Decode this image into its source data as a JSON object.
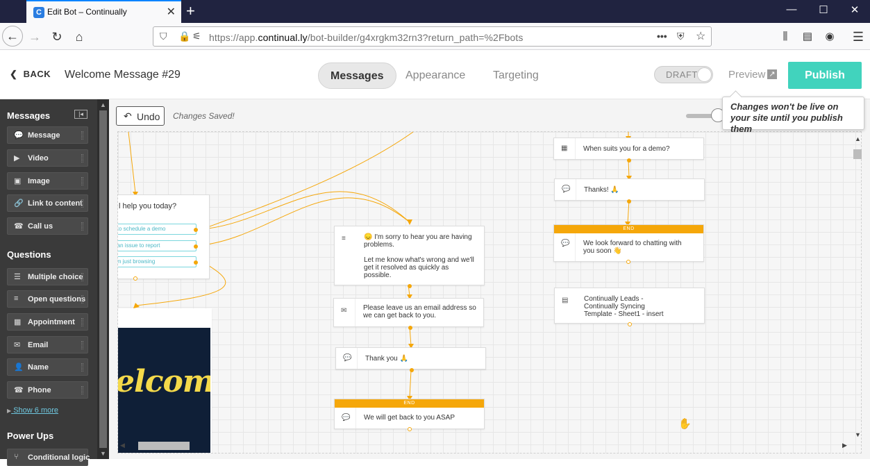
{
  "browser": {
    "tab_title": "Edit Bot – Continually",
    "favicon": "C",
    "url_prefix": "https://app.",
    "url_domain": "continual.ly",
    "url_rest": "/bot-builder/g4xrgkm32rn3?return_path=%2Fbots"
  },
  "header": {
    "back_label": "BACK",
    "page_title": "Welcome Message #29",
    "tabs": [
      "Messages",
      "Appearance",
      "Targeting"
    ],
    "draft_label": "DRAFT",
    "preview_label": "Preview",
    "publish_label": "Publish"
  },
  "sidebar": {
    "messages_heading": "Messages",
    "message_items": [
      {
        "label": "Message",
        "icon": "chat-icon"
      },
      {
        "label": "Video",
        "icon": "video-icon"
      },
      {
        "label": "Image",
        "icon": "image-icon"
      },
      {
        "label": "Link to content",
        "icon": "link-icon"
      },
      {
        "label": "Call us",
        "icon": "phone-icon"
      }
    ],
    "questions_heading": "Questions",
    "question_items": [
      {
        "label": "Multiple choice",
        "icon": "list-icon"
      },
      {
        "label": "Open questions",
        "icon": "lines-icon"
      },
      {
        "label": "Appointment",
        "icon": "calendar-icon"
      },
      {
        "label": "Email",
        "icon": "envelope-icon"
      },
      {
        "label": "Name",
        "icon": "user-icon"
      },
      {
        "label": "Phone",
        "icon": "phone-icon"
      }
    ],
    "show_more": "Show 6 more",
    "powerups_heading": "Power Ups",
    "powerup_items": [
      {
        "label": "Conditional logic",
        "icon": "branch-icon"
      }
    ]
  },
  "toolbar": {
    "undo_label": "Undo",
    "status": "Changes Saved!",
    "tooltip": "Changes won't be live on your site until you publish them"
  },
  "nodes": {
    "question_title": "l help you today?",
    "choices": [
      "e to schedule a demo",
      "e an issue to report",
      "I'm just browsing"
    ],
    "welcome_image_text": "elcome",
    "sorry_text_1": "😞 I'm sorry to hear you are having problems.",
    "sorry_text_2": "Let me know what's wrong and we'll get it resolved as quickly as possible.",
    "email_text": "Please leave us an email address so we can get back to you.",
    "thank_you_text": "Thank you 🙏",
    "asap_text": "We will get back to you ASAP",
    "end_label": "END",
    "demo_text": "When suits you for a demo?",
    "thanks_text": "Thanks! 🙏",
    "look_forward_text": "We look forward to chatting with you soon 👋",
    "leads_text": "Continually Leads - Continually Syncing Template - Sheet1 - insert"
  },
  "colors": {
    "publish": "#41d3bd",
    "connector": "#f5a70a",
    "choice_border": "#7ad6dd",
    "sidebar": "#3a3a3a"
  }
}
